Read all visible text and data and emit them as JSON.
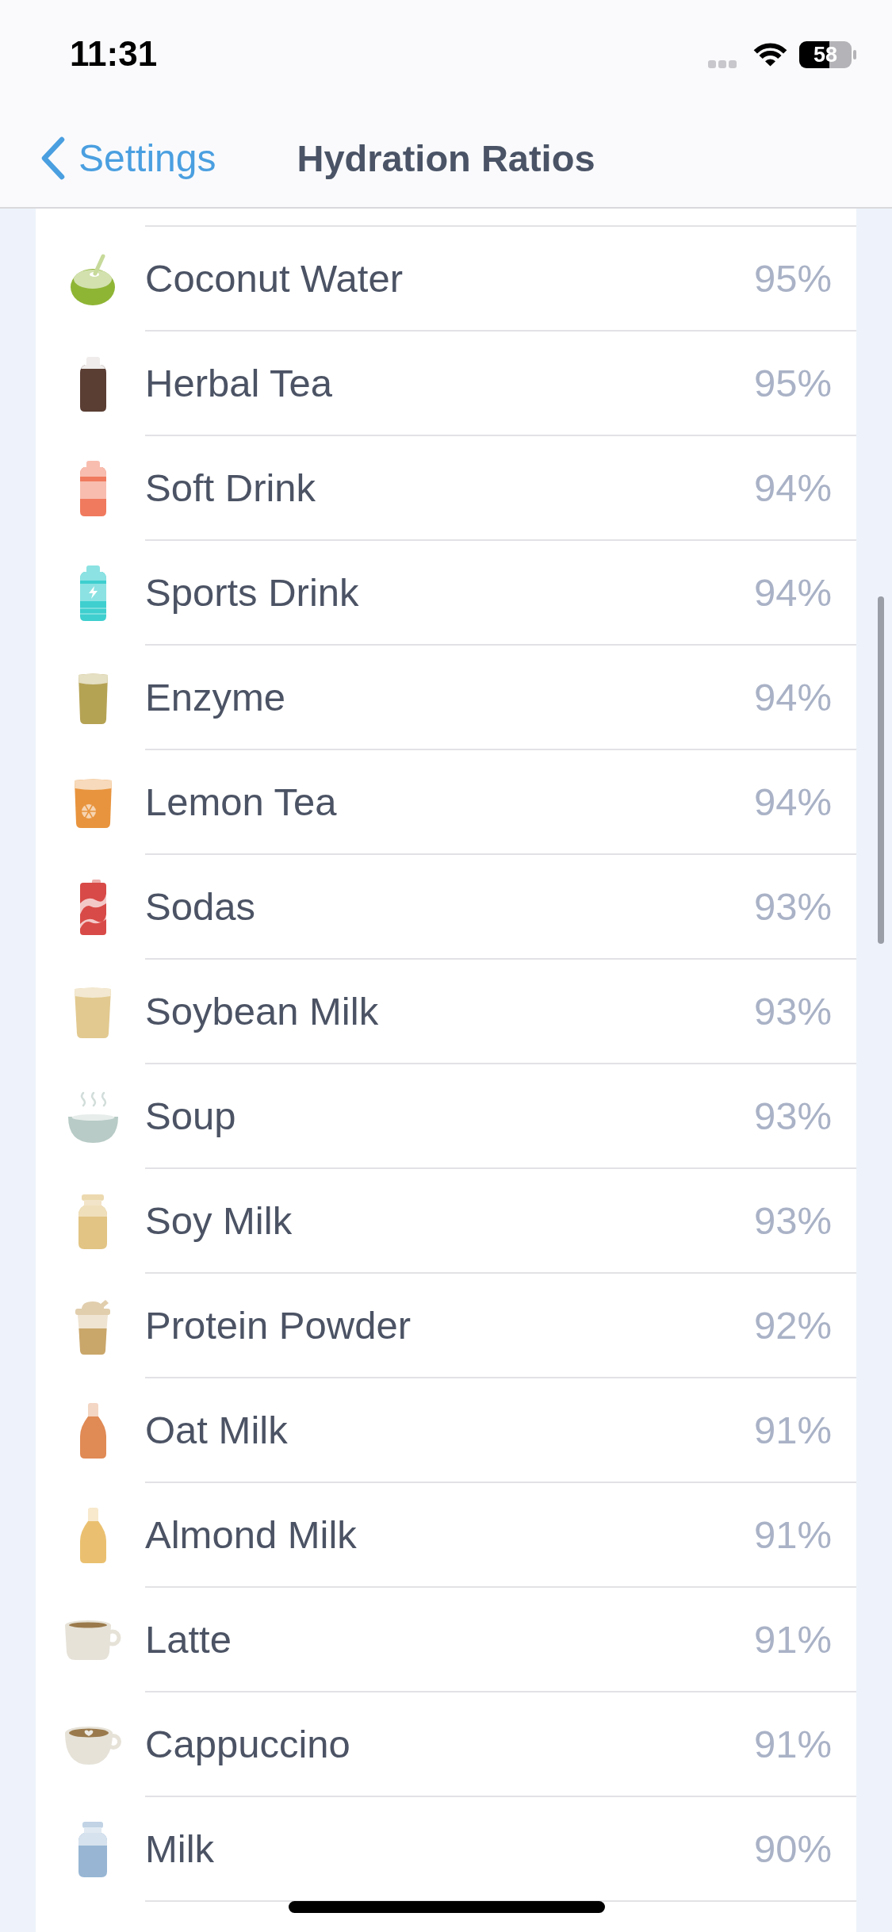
{
  "status_bar": {
    "time": "11:31",
    "battery": "58"
  },
  "nav_bar": {
    "back_label": "Settings",
    "title": "Hydration Ratios"
  },
  "drinks": [
    {
      "name": "Coconut Water",
      "ratio": "95%",
      "kind": "coconut",
      "color": "#8fb535"
    },
    {
      "name": "Herbal Tea",
      "ratio": "95%",
      "kind": "bottle",
      "color": "#5a3d33"
    },
    {
      "name": "Soft Drink",
      "ratio": "94%",
      "kind": "soda-bottle",
      "color": "#f07a5e"
    },
    {
      "name": "Sports Drink",
      "ratio": "94%",
      "kind": "sports-bottle",
      "color": "#3fcfcf"
    },
    {
      "name": "Enzyme",
      "ratio": "94%",
      "kind": "glass",
      "color": "#b5a354"
    },
    {
      "name": "Lemon Tea",
      "ratio": "94%",
      "kind": "juice-glass",
      "color": "#e8943e"
    },
    {
      "name": "Sodas",
      "ratio": "93%",
      "kind": "can",
      "color": "#d84a47"
    },
    {
      "name": "Soybean Milk",
      "ratio": "93%",
      "kind": "pint-glass",
      "color": "#e2c98f"
    },
    {
      "name": "Soup",
      "ratio": "93%",
      "kind": "bowl",
      "color": "#b8cbc6"
    },
    {
      "name": "Soy Milk",
      "ratio": "93%",
      "kind": "jar",
      "color": "#e2c484"
    },
    {
      "name": "Protein Powder",
      "ratio": "92%",
      "kind": "shaker",
      "color": "#c9a66a"
    },
    {
      "name": "Oat Milk",
      "ratio": "91%",
      "kind": "tall-bottle",
      "color": "#e08a55"
    },
    {
      "name": "Almond Milk",
      "ratio": "91%",
      "kind": "tall-bottle",
      "color": "#eac070"
    },
    {
      "name": "Latte",
      "ratio": "91%",
      "kind": "cup",
      "color": "#e6e2d8"
    },
    {
      "name": "Cappuccino",
      "ratio": "91%",
      "kind": "art-cup",
      "color": "#e6e2d8"
    },
    {
      "name": "Milk",
      "ratio": "90%",
      "kind": "milk-bottle",
      "color": "#98b6d4"
    }
  ]
}
